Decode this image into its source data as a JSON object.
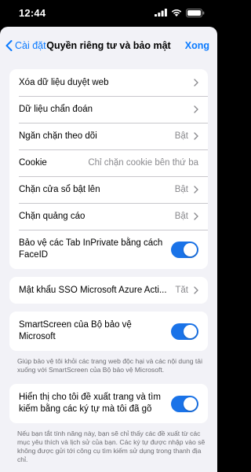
{
  "status_bar": {
    "time": "12:44"
  },
  "nav": {
    "back_label": "Cài đặt",
    "title": "Quyền riêng tư và bảo mật",
    "done_label": "Xong"
  },
  "group1": {
    "items": [
      {
        "label": "Xóa dữ liệu duyệt web",
        "value": ""
      },
      {
        "label": "Dữ liệu chẩn đoán",
        "value": ""
      },
      {
        "label": "Ngăn chặn theo dõi",
        "value": "Bật"
      },
      {
        "label": "Cookie",
        "value": "Chỉ chặn cookie bên thứ ba"
      },
      {
        "label": "Chặn cửa sổ bật lên",
        "value": "Bật"
      },
      {
        "label": "Chặn quảng cáo",
        "value": "Bật"
      }
    ],
    "faceid": {
      "label": "Bảo vệ các Tab InPrivate bằng cách FaceID",
      "on": true
    }
  },
  "group2": {
    "sso": {
      "label": "Mật khẩu SSO Microsoft Azure Acti...",
      "value": "Tắt"
    }
  },
  "group3": {
    "smartscreen": {
      "label": "SmartScreen của Bộ bảo vệ Microsoft",
      "on": true
    },
    "footnote": "Giúp bảo vệ tôi khỏi các trang web độc hại và các nội dung tải xuống với SmartScreen của Bộ bảo vệ Microsoft."
  },
  "group4": {
    "suggest": {
      "label": "Hiển thị cho tôi đề xuất trang và tìm kiếm bằng các ký tự mà tôi đã gõ",
      "on": true
    },
    "footnote": "Nếu bạn tắt tính năng này, bạn sẽ chỉ thấy các đề xuất từ các mục yêu thích và lịch sử của bạn. Các ký tự được nhập vào sẽ không được gửi tới công cụ tìm kiếm sử dụng trong thanh địa chỉ."
  },
  "colors": {
    "accent": "#0a7aff",
    "toggle_on": "#1a73e8",
    "background": "#f2f2f7"
  }
}
